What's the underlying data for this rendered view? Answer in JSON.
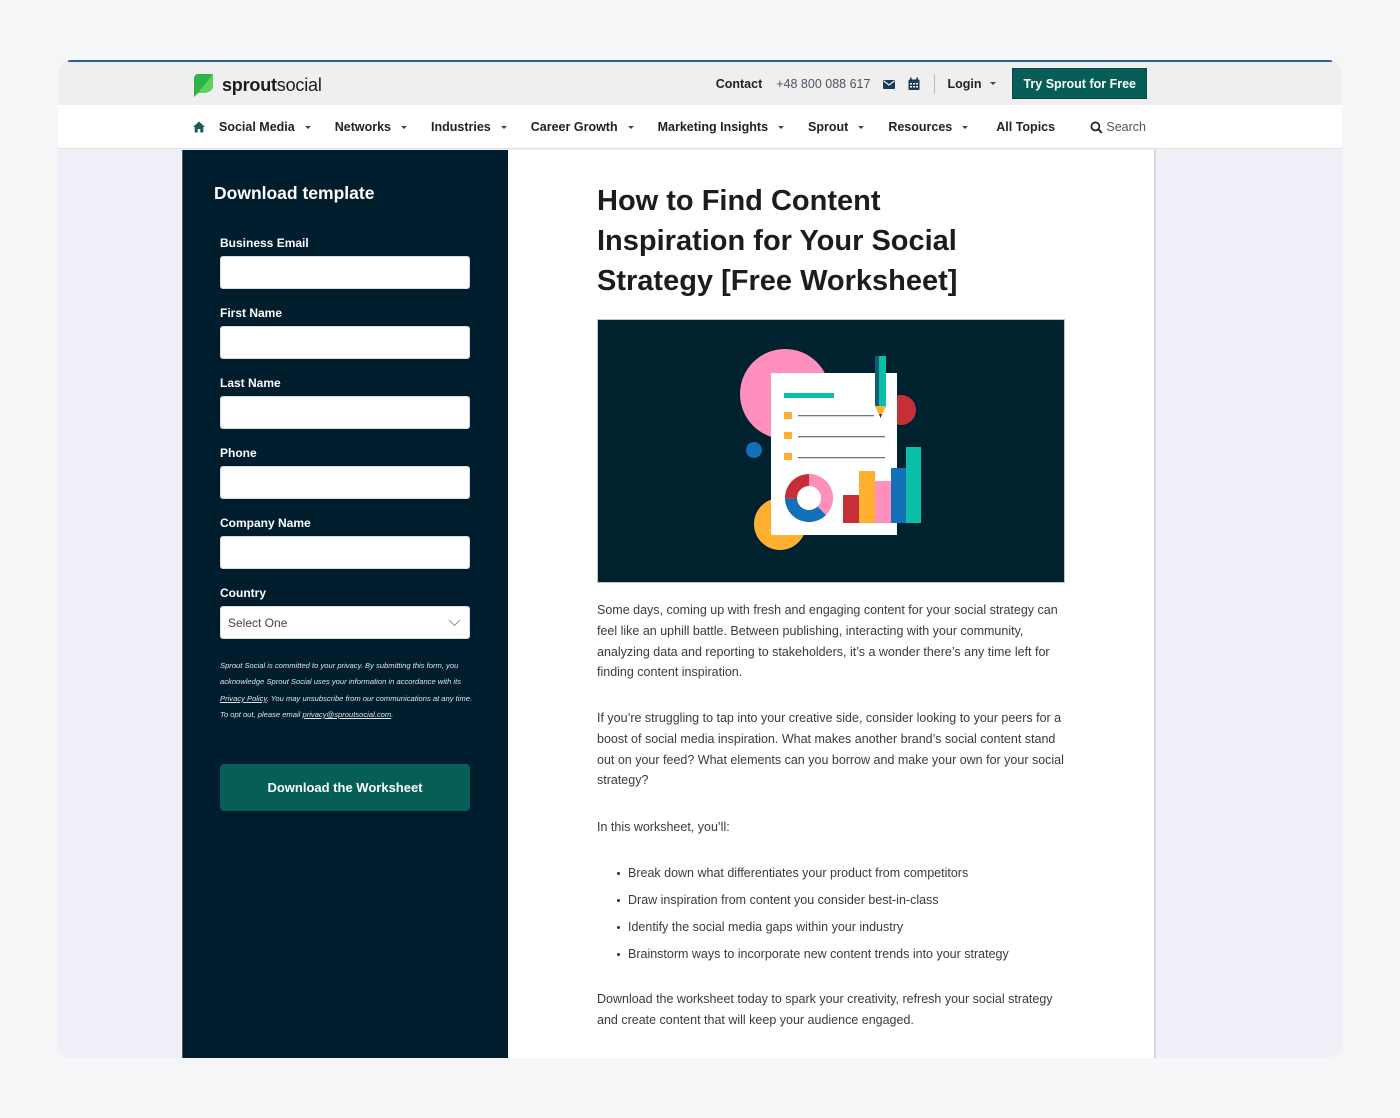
{
  "header": {
    "brand_bold": "sprout",
    "brand_light": "social",
    "contact_label": "Contact",
    "phone": "+48 800 088 617",
    "login_label": "Login",
    "cta_label": "Try Sprout for Free"
  },
  "nav": {
    "items": [
      {
        "label": "Social Media",
        "dropdown": true
      },
      {
        "label": "Networks",
        "dropdown": true
      },
      {
        "label": "Industries",
        "dropdown": true
      },
      {
        "label": "Career Growth",
        "dropdown": true
      },
      {
        "label": "Marketing Insights",
        "dropdown": true
      },
      {
        "label": "Sprout",
        "dropdown": true
      },
      {
        "label": "Resources",
        "dropdown": true
      },
      {
        "label": "All Topics",
        "dropdown": false
      }
    ],
    "search_label": "Search"
  },
  "form": {
    "heading": "Download template",
    "fields": [
      {
        "label": "Business Email",
        "value": ""
      },
      {
        "label": "First Name",
        "value": ""
      },
      {
        "label": "Last Name",
        "value": ""
      },
      {
        "label": "Phone",
        "value": ""
      },
      {
        "label": "Company Name",
        "value": ""
      }
    ],
    "country": {
      "label": "Country",
      "selected": "Select One"
    },
    "privacy": {
      "text_1": "Sprout Social is committed to your privacy. By submitting this form, you acknowledge Sprout Social uses your information in accordance with its ",
      "policy_link": "Privacy Policy",
      "text_2": ". You may unsubscribe from our communications at any time. To opt out, please email ",
      "email_link": "privacy@sproutsocial.com",
      "text_3": "."
    },
    "submit_label": "Download the Worksheet"
  },
  "article": {
    "title": "How to Find Content Inspiration for Your Social Strategy [Free Worksheet]",
    "hero_alt": "worksheet-illustration",
    "paragraphs": [
      "Some days, coming up with fresh and engaging content for your social strategy can feel like an uphill battle. Between publishing, interacting with your community, analyzing data and reporting to stakeholders, it’s a wonder there’s any time left for finding content inspiration.",
      "If you’re struggling to tap into your creative side, consider looking to your peers for a boost of social media inspiration. What makes another brand’s social content stand out on your feed? What elements can you borrow and make your own for your social strategy?",
      "In this worksheet, you’ll:"
    ],
    "bullets": [
      "Break down what differentiates your product from competitors",
      "Draw inspiration from content you consider best-in-class",
      "Identify the social media gaps within your industry",
      "Brainstorm ways to incorporate new content trends into your strategy"
    ],
    "closing": "Download the worksheet today to spark your creativity, refresh your social strategy and create content that will keep your audience engaged."
  },
  "colors": {
    "brand_green": "#075e57",
    "sidebar_navy": "#001d2e",
    "logo_green": "#59cb59"
  }
}
